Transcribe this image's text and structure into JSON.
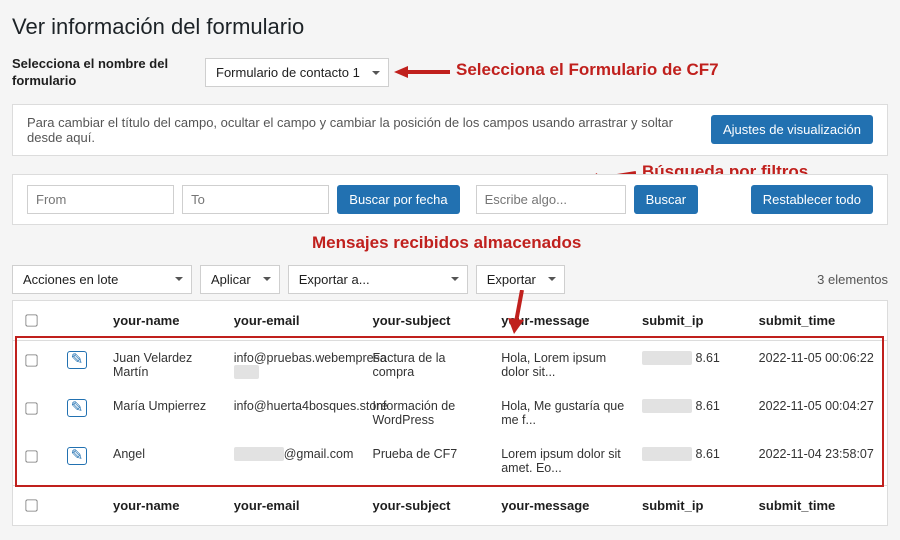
{
  "page_title": "Ver información del formulario",
  "form_select": {
    "label": "Selecciona el nombre del formulario",
    "value": "Formulario de contacto 1"
  },
  "annotations": {
    "select_form": "Selecciona el Formulario de CF7",
    "filters": "Búsqueda por filtros",
    "stored": "Mensajes recibidos almacenados"
  },
  "display_panel": {
    "text": "Para cambiar el título del campo, ocultar el campo y cambiar la posición de los campos usando arrastrar y soltar desde aquí.",
    "button": "Ajustes de visualización"
  },
  "filters": {
    "from_placeholder": "From",
    "to_placeholder": "To",
    "date_btn": "Buscar por fecha",
    "search_placeholder": "Escribe algo...",
    "search_btn": "Buscar",
    "reset_btn": "Restablecer todo"
  },
  "bulk": {
    "actions": "Acciones en lote",
    "apply": "Aplicar",
    "export_to": "Exportar a...",
    "export": "Exportar",
    "count": "3 elementos"
  },
  "columns": {
    "name": "your-name",
    "email": "your-email",
    "subject": "your-subject",
    "message": "your-message",
    "ip": "submit_ip",
    "time": "submit_time"
  },
  "rows": [
    {
      "name": "Juan Velardez Martín",
      "email_prefix": "info@pruebas.webempresa",
      "subject": "Factura de la compra",
      "message": "Hola, Lorem ipsum dolor sit...",
      "ip_suffix": "8.61",
      "time": "2022-11-05 00:06:22"
    },
    {
      "name": "María Umpierrez",
      "email_prefix": "info@huerta4bosques.store",
      "subject": "Información de WordPress",
      "message": "Hola, Me gustaría que me f...",
      "ip_suffix": "8.61",
      "time": "2022-11-05 00:04:27"
    },
    {
      "name": "Angel",
      "email_prefix": "@gmail.com",
      "subject": "Prueba de CF7",
      "message": "Lorem ipsum dolor sit amet. Eo...",
      "ip_suffix": "8.61",
      "time": "2022-11-04 23:58:07"
    }
  ]
}
